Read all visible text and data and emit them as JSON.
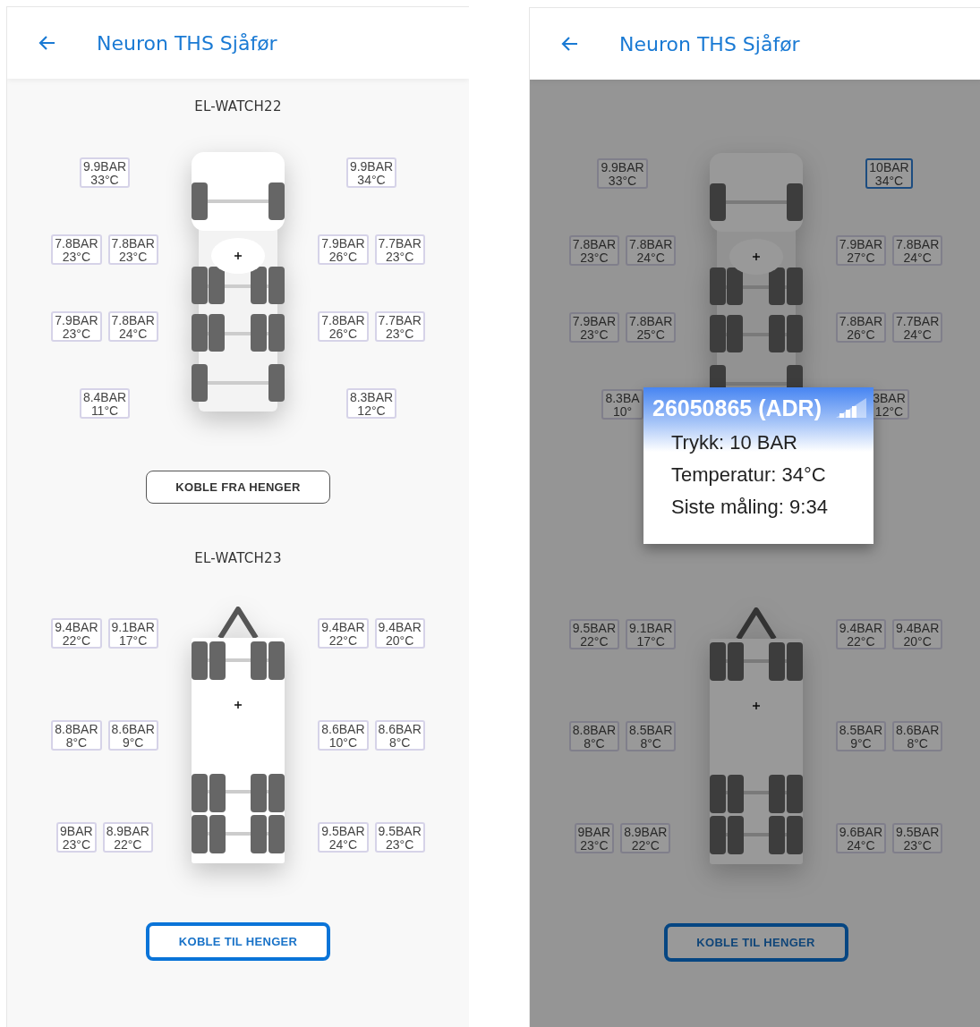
{
  "panels": [
    {
      "header": {
        "title": "Neuron THS Sjåfør"
      },
      "dimmed": false,
      "vehicles": [
        {
          "kind": "truck",
          "title": "EL-WATCH22",
          "rows": [
            {
              "left": [
                {
                  "pressure": "9.9BAR",
                  "temperature": "33°C",
                  "selected": false
                }
              ],
              "right": [
                {
                  "pressure": "9.9BAR",
                  "temperature": "34°C",
                  "selected": false
                }
              ]
            },
            {
              "left": [
                {
                  "pressure": "7.8BAR",
                  "temperature": "23°C",
                  "selected": false
                },
                {
                  "pressure": "7.8BAR",
                  "temperature": "23°C",
                  "selected": false
                }
              ],
              "right": [
                {
                  "pressure": "7.9BAR",
                  "temperature": "26°C",
                  "selected": false
                },
                {
                  "pressure": "7.7BAR",
                  "temperature": "23°C",
                  "selected": false
                }
              ]
            },
            {
              "left": [
                {
                  "pressure": "7.9BAR",
                  "temperature": "23°C",
                  "selected": false
                },
                {
                  "pressure": "7.8BAR",
                  "temperature": "24°C",
                  "selected": false
                }
              ],
              "right": [
                {
                  "pressure": "7.8BAR",
                  "temperature": "26°C",
                  "selected": false
                },
                {
                  "pressure": "7.7BAR",
                  "temperature": "23°C",
                  "selected": false
                }
              ]
            },
            {
              "left": [
                {
                  "pressure": "8.4BAR",
                  "temperature": "11°C",
                  "selected": false
                }
              ],
              "right": [
                {
                  "pressure": "8.3BAR",
                  "temperature": "12°C",
                  "selected": false
                }
              ]
            }
          ],
          "button": {
            "label": "KOBLE FRA HENGER",
            "kind": "outline"
          }
        },
        {
          "kind": "trailer",
          "title": "EL-WATCH23",
          "rows": [
            {
              "left": [
                {
                  "pressure": "9.4BAR",
                  "temperature": "22°C",
                  "selected": false
                },
                {
                  "pressure": "9.1BAR",
                  "temperature": "17°C",
                  "selected": false
                }
              ],
              "right": [
                {
                  "pressure": "9.4BAR",
                  "temperature": "22°C",
                  "selected": false
                },
                {
                  "pressure": "9.4BAR",
                  "temperature": "20°C",
                  "selected": false
                }
              ]
            },
            {
              "left": [
                {
                  "pressure": "8.8BAR",
                  "temperature": "8°C",
                  "selected": false
                },
                {
                  "pressure": "8.6BAR",
                  "temperature": "9°C",
                  "selected": false
                }
              ],
              "right": [
                {
                  "pressure": "8.6BAR",
                  "temperature": "10°C",
                  "selected": false
                },
                {
                  "pressure": "8.6BAR",
                  "temperature": "8°C",
                  "selected": false
                }
              ]
            },
            {
              "left": [
                {
                  "pressure": "9BAR",
                  "temperature": "23°C",
                  "selected": false
                },
                {
                  "pressure": "8.9BAR",
                  "temperature": "22°C",
                  "selected": false
                }
              ],
              "right": [
                {
                  "pressure": "9.5BAR",
                  "temperature": "24°C",
                  "selected": false
                },
                {
                  "pressure": "9.5BAR",
                  "temperature": "23°C",
                  "selected": false
                }
              ]
            }
          ],
          "button": {
            "label": "KOBLE TIL HENGER",
            "kind": "primary"
          }
        }
      ]
    },
    {
      "header": {
        "title": "Neuron THS Sjåfør"
      },
      "dimmed": true,
      "vehicles": [
        {
          "kind": "truck",
          "rows": [
            {
              "left": [
                {
                  "pressure": "9.9BAR",
                  "temperature": "33°C",
                  "selected": false
                }
              ],
              "right": [
                {
                  "pressure": "10BAR",
                  "temperature": "34°C",
                  "selected": true
                }
              ]
            },
            {
              "left": [
                {
                  "pressure": "7.8BAR",
                  "temperature": "23°C",
                  "selected": false
                },
                {
                  "pressure": "7.8BAR",
                  "temperature": "24°C",
                  "selected": false
                }
              ],
              "right": [
                {
                  "pressure": "7.9BAR",
                  "temperature": "27°C",
                  "selected": false
                },
                {
                  "pressure": "7.8BAR",
                  "temperature": "24°C",
                  "selected": false
                }
              ]
            },
            {
              "left": [
                {
                  "pressure": "7.9BAR",
                  "temperature": "23°C",
                  "selected": false
                },
                {
                  "pressure": "7.8BAR",
                  "temperature": "25°C",
                  "selected": false
                }
              ],
              "right": [
                {
                  "pressure": "7.8BAR",
                  "temperature": "26°C",
                  "selected": false
                },
                {
                  "pressure": "7.7BAR",
                  "temperature": "24°C",
                  "selected": false
                }
              ]
            },
            {
              "left": [
                {
                  "pressure": "8.3BA",
                  "temperature": "10°",
                  "selected": false
                }
              ],
              "right": [
                {
                  "pressure": "3BAR",
                  "temperature": "12°C",
                  "selected": false
                }
              ]
            }
          ]
        },
        {
          "kind": "trailer",
          "rows": [
            {
              "left": [
                {
                  "pressure": "9.5BAR",
                  "temperature": "22°C",
                  "selected": false
                },
                {
                  "pressure": "9.1BAR",
                  "temperature": "17°C",
                  "selected": false
                }
              ],
              "right": [
                {
                  "pressure": "9.4BAR",
                  "temperature": "22°C",
                  "selected": false
                },
                {
                  "pressure": "9.4BAR",
                  "temperature": "20°C",
                  "selected": false
                }
              ]
            },
            {
              "left": [
                {
                  "pressure": "8.8BAR",
                  "temperature": "8°C",
                  "selected": false
                },
                {
                  "pressure": "8.5BAR",
                  "temperature": "8°C",
                  "selected": false
                }
              ],
              "right": [
                {
                  "pressure": "8.5BAR",
                  "temperature": "9°C",
                  "selected": false
                },
                {
                  "pressure": "8.6BAR",
                  "temperature": "8°C",
                  "selected": false
                }
              ]
            },
            {
              "left": [
                {
                  "pressure": "9BAR",
                  "temperature": "23°C",
                  "selected": false
                },
                {
                  "pressure": "8.9BAR",
                  "temperature": "22°C",
                  "selected": false
                }
              ],
              "right": [
                {
                  "pressure": "9.6BAR",
                  "temperature": "24°C",
                  "selected": false
                },
                {
                  "pressure": "9.5BAR",
                  "temperature": "23°C",
                  "selected": false
                }
              ]
            }
          ],
          "button": {
            "label": "KOBLE TIL HENGER",
            "kind": "primary"
          }
        }
      ],
      "popup": {
        "title": "26050865 (ADR)",
        "lines": [
          "Trykk: 10 BAR",
          "Temperatur: 34°C",
          "Siste måling: 9:34"
        ]
      }
    }
  ]
}
